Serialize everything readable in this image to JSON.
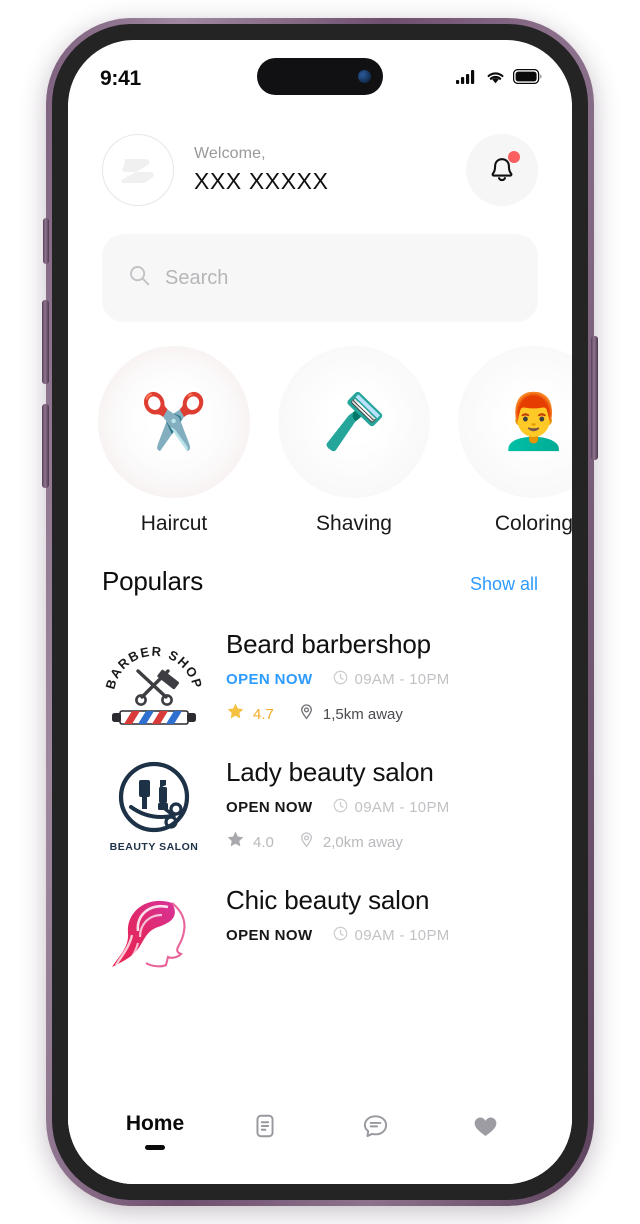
{
  "device": {
    "frame_color": "#7d5f7d",
    "status_bar": {
      "time": "9:41",
      "signal_icon": "cellular-signal-icon",
      "wifi_icon": "wifi-icon",
      "battery_icon": "battery-icon"
    }
  },
  "header": {
    "avatar_icon": "avatar-placeholder-icon",
    "greeting": "Welcome,",
    "user_name": "XXX XXXXX",
    "bell_icon": "notification-bell-icon",
    "badge_color": "#fb5f5f"
  },
  "search": {
    "placeholder": "Search",
    "icon": "search-icon"
  },
  "categories": [
    {
      "label": "Haircut",
      "emoji": "✂️",
      "icon": "scissors-icon"
    },
    {
      "label": "Shaving",
      "emoji": "🪒",
      "icon": "razor-icon"
    },
    {
      "label": "Coloring",
      "emoji": "👨‍🦰",
      "icon": "person-red-hair-icon"
    }
  ],
  "populars": {
    "title": "Populars",
    "show_all": "Show all",
    "accent_color": "#2e9bff",
    "items": [
      {
        "name": "Beard barbershop",
        "status": "OPEN NOW",
        "status_style": "accent",
        "hours": "09AM - 10PM",
        "rating": "4.7",
        "rating_style": "gold",
        "distance": "1,5km away",
        "distance_style": "dark",
        "logo": "barber-shop-logo",
        "logo_caption": "BARBER SHOP"
      },
      {
        "name": "Lady beauty salon",
        "status": "OPEN NOW",
        "status_style": "plain",
        "hours": "09AM - 10PM",
        "rating": "4.0",
        "rating_style": "gray",
        "distance": "2,0km away",
        "distance_style": "gray",
        "logo": "beauty-salon-logo",
        "logo_caption": "BEAUTY SALON"
      },
      {
        "name": "Chic beauty salon",
        "status": "OPEN NOW",
        "status_style": "plain",
        "hours": "09AM - 10PM",
        "rating": "",
        "rating_style": "gray",
        "distance": "",
        "distance_style": "gray",
        "logo": "chic-salon-logo",
        "logo_caption": ""
      }
    ]
  },
  "bottom_nav": {
    "items": [
      {
        "label": "Home",
        "icon": "home-label",
        "active": true
      },
      {
        "label": "",
        "icon": "document-icon",
        "active": false
      },
      {
        "label": "",
        "icon": "chat-bubble-icon",
        "active": false
      },
      {
        "label": "",
        "icon": "heart-icon",
        "active": false
      }
    ]
  }
}
